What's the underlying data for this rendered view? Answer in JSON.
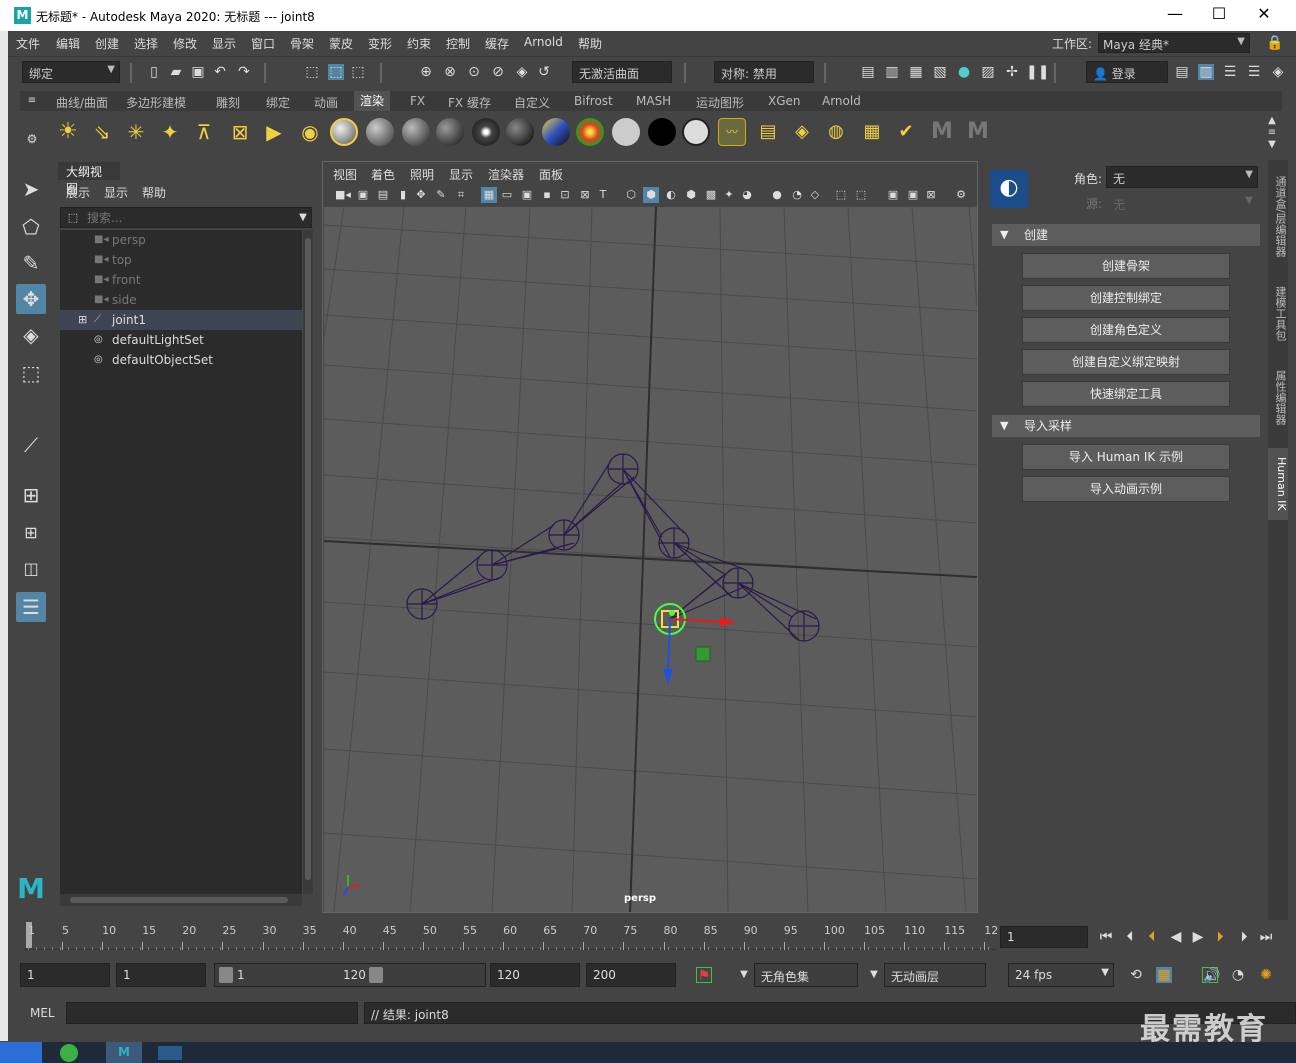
{
  "window": {
    "title": "无标题* - Autodesk Maya 2020: 无标题   ---   joint8",
    "app_icon": "M"
  },
  "menubar": {
    "items": [
      "文件",
      "编辑",
      "创建",
      "选择",
      "修改",
      "显示",
      "窗口",
      "骨架",
      "蒙皮",
      "变形",
      "约束",
      "控制",
      "缓存",
      "Arnold",
      "帮助"
    ],
    "workspace_label": "工作区:",
    "workspace_value": "Maya 经典*"
  },
  "statusline": {
    "menuset": "绑定",
    "live_surface": "无激活曲面",
    "symmetry": "对称: 禁用",
    "login": "登录"
  },
  "shelf": {
    "tabs": [
      "曲线/曲面",
      "多边形建模",
      "雕刻",
      "绑定",
      "动画",
      "渲染",
      "FX",
      "FX 缓存",
      "自定义",
      "Bifrost",
      "MASH",
      "运动图形",
      "XGen",
      "Arnold"
    ],
    "active_tab": "渲染"
  },
  "outliner": {
    "tab_label": "大纲视图",
    "menus": [
      "展示",
      "显示",
      "帮助"
    ],
    "search_placeholder": "搜索...",
    "items": [
      {
        "label": "persp",
        "dim": true
      },
      {
        "label": "top",
        "dim": true
      },
      {
        "label": "front",
        "dim": true
      },
      {
        "label": "side",
        "dim": true
      },
      {
        "label": "joint1",
        "dim": false
      },
      {
        "label": "defaultLightSet",
        "dim": false
      },
      {
        "label": "defaultObjectSet",
        "dim": false
      }
    ]
  },
  "viewport": {
    "menus": [
      "视图",
      "着色",
      "照明",
      "显示",
      "渲染器",
      "面板"
    ],
    "camera_label": "persp"
  },
  "humanik": {
    "character_label": "角色:",
    "character_value": "无",
    "source_label": "源:",
    "source_value": "无",
    "section_create": "创建",
    "create_buttons": [
      "创建骨架",
      "创建控制绑定",
      "创建角色定义",
      "创建自定义绑定映射",
      "快速绑定工具"
    ],
    "section_import": "导入采样",
    "import_buttons": [
      "导入 Human IK 示例",
      "导入动画示例"
    ],
    "side_tabs": [
      "通道盒/层编辑器",
      "建模工具包",
      "属性编辑器",
      "Human IK"
    ]
  },
  "timeslider": {
    "ticks": [
      "1",
      "5",
      "10",
      "15",
      "20",
      "25",
      "30",
      "35",
      "40",
      "45",
      "50",
      "55",
      "60",
      "65",
      "70",
      "75",
      "80",
      "85",
      "90",
      "95",
      "100",
      "105",
      "110",
      "115",
      "12"
    ],
    "current_frame": "1"
  },
  "rangebar": {
    "start": "1",
    "playback_start": "1",
    "range_start": "1",
    "range_end": "120",
    "playback_end": "120",
    "end": "200",
    "character_set": "无角色集",
    "anim_layer": "无动画层",
    "fps": "24 fps"
  },
  "commandline": {
    "lang": "MEL",
    "result": "// 结果: joint8"
  },
  "watermark": "最需教育",
  "colors": {
    "joint": "#2a1a4a",
    "selected": "#44ff44",
    "axis_x": "#e02020",
    "axis_y": "#20c020",
    "axis_z": "#2050e0"
  }
}
